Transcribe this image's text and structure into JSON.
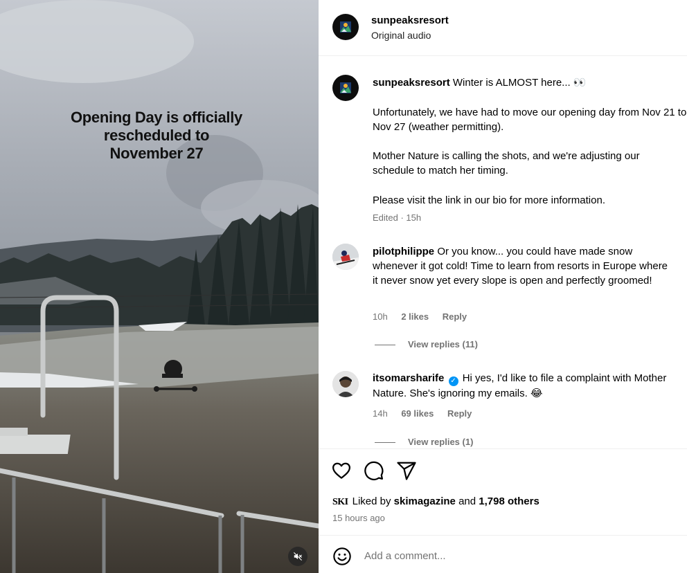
{
  "media": {
    "overlay_lines": [
      "Opening Day is officially",
      "rescheduled to",
      "November 27"
    ],
    "mute_icon": "speaker-muted-icon"
  },
  "header": {
    "username": "sunpeaksresort",
    "subtitle": "Original audio"
  },
  "caption": {
    "username": "sunpeaksresort",
    "first_line": "Winter is ALMOST here... 👀",
    "para1": "Unfortunately, we have had to move our opening day from Nov 21 to Nov 27 (weather permitting).",
    "para2": "Mother Nature is calling the shots, and we're adjusting our schedule to match her timing.",
    "para3": "Please visit the link in our bio for more information.",
    "meta": "Edited · 15h"
  },
  "comments": [
    {
      "username": "pilotphilippe",
      "text": "Or you know... you could have made snow whenever it got cold! Time to learn from resorts in Europe where it never snow yet every slope is open and perfectly groomed!",
      "time": "10h",
      "likes": "2 likes",
      "reply": "Reply",
      "view_replies": "View replies (11)"
    },
    {
      "username": "itsomarsharife",
      "verified": true,
      "text": "Hi yes, I'd like to file a complaint with Mother Nature. She's ignoring my emails. 😂",
      "time": "14h",
      "likes": "69 likes",
      "reply": "Reply",
      "view_replies": "View replies (1)"
    }
  ],
  "actions": {
    "icons": [
      "heart-icon",
      "comment-icon",
      "share-icon"
    ],
    "liked_brand": "SKI",
    "liked_prefix": "Liked by",
    "liked_user": "skimagazine",
    "liked_and": "and",
    "liked_others": "1,798 others",
    "time_ago": "15 hours ago"
  },
  "add_comment": {
    "placeholder": "Add a comment..."
  },
  "colors": {
    "muted_text": "#737373",
    "verified": "#0095f6",
    "divider": "#efefef"
  }
}
